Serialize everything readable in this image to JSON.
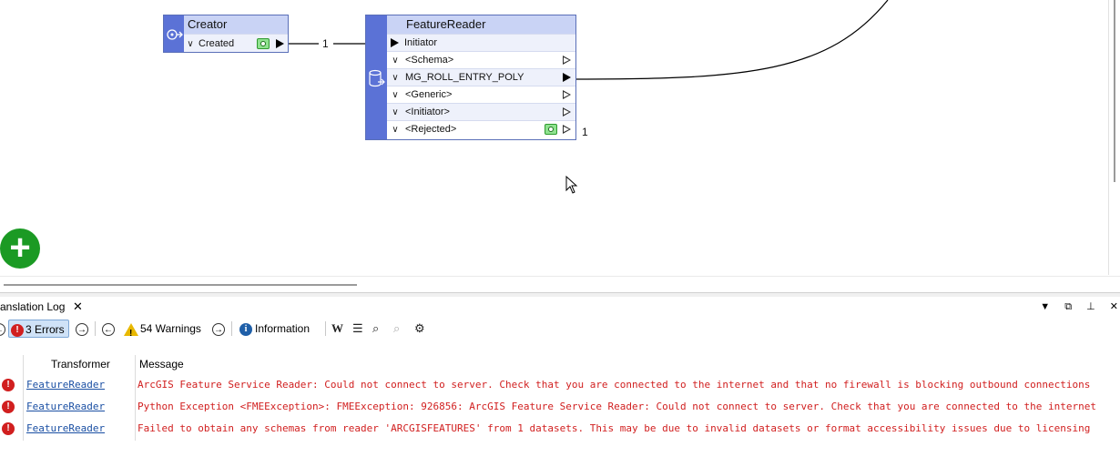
{
  "canvas": {
    "creator": {
      "title": "Creator",
      "port": "Created",
      "out_count": "1"
    },
    "feature_reader": {
      "title": "FeatureReader",
      "input_port": "Initiator",
      "ports": [
        "<Schema>",
        "MG_ROLL_ENTRY_POLY",
        "<Generic>",
        "<Initiator>",
        "<Rejected>"
      ],
      "rejected_count": "1"
    }
  },
  "log_panel": {
    "tab_label": "anslation Log",
    "close": "✕",
    "window_buttons": [
      "▼",
      "⧉",
      "⊥",
      "✕"
    ]
  },
  "log_toolbar": {
    "errors": "3 Errors",
    "warnings": "54 Warnings",
    "information": "Information"
  },
  "log_table": {
    "columns": [
      "Transformer",
      "Message"
    ],
    "rows": [
      {
        "transformer": "FeatureReader",
        "message": "ArcGIS Feature Service Reader: Could not connect to server. Check that you are connected to the internet and that no firewall is blocking outbound connections"
      },
      {
        "transformer": "FeatureReader",
        "message": "Python Exception <FMEException>: FMEException: 926856: ArcGIS Feature Service Reader: Could not connect to server. Check that you are connected to the internet"
      },
      {
        "transformer": "FeatureReader",
        "message": "Failed to obtain any schemas from reader 'ARCGISFEATURES' from 1 datasets. This may be due to invalid datasets or format accessibility issues due to licensing"
      }
    ]
  },
  "colors": {
    "node_strip": "#5b72d6",
    "node_header": "#c9d3f5",
    "error_red": "#d11f1f",
    "add_button": "#1b9a24"
  }
}
